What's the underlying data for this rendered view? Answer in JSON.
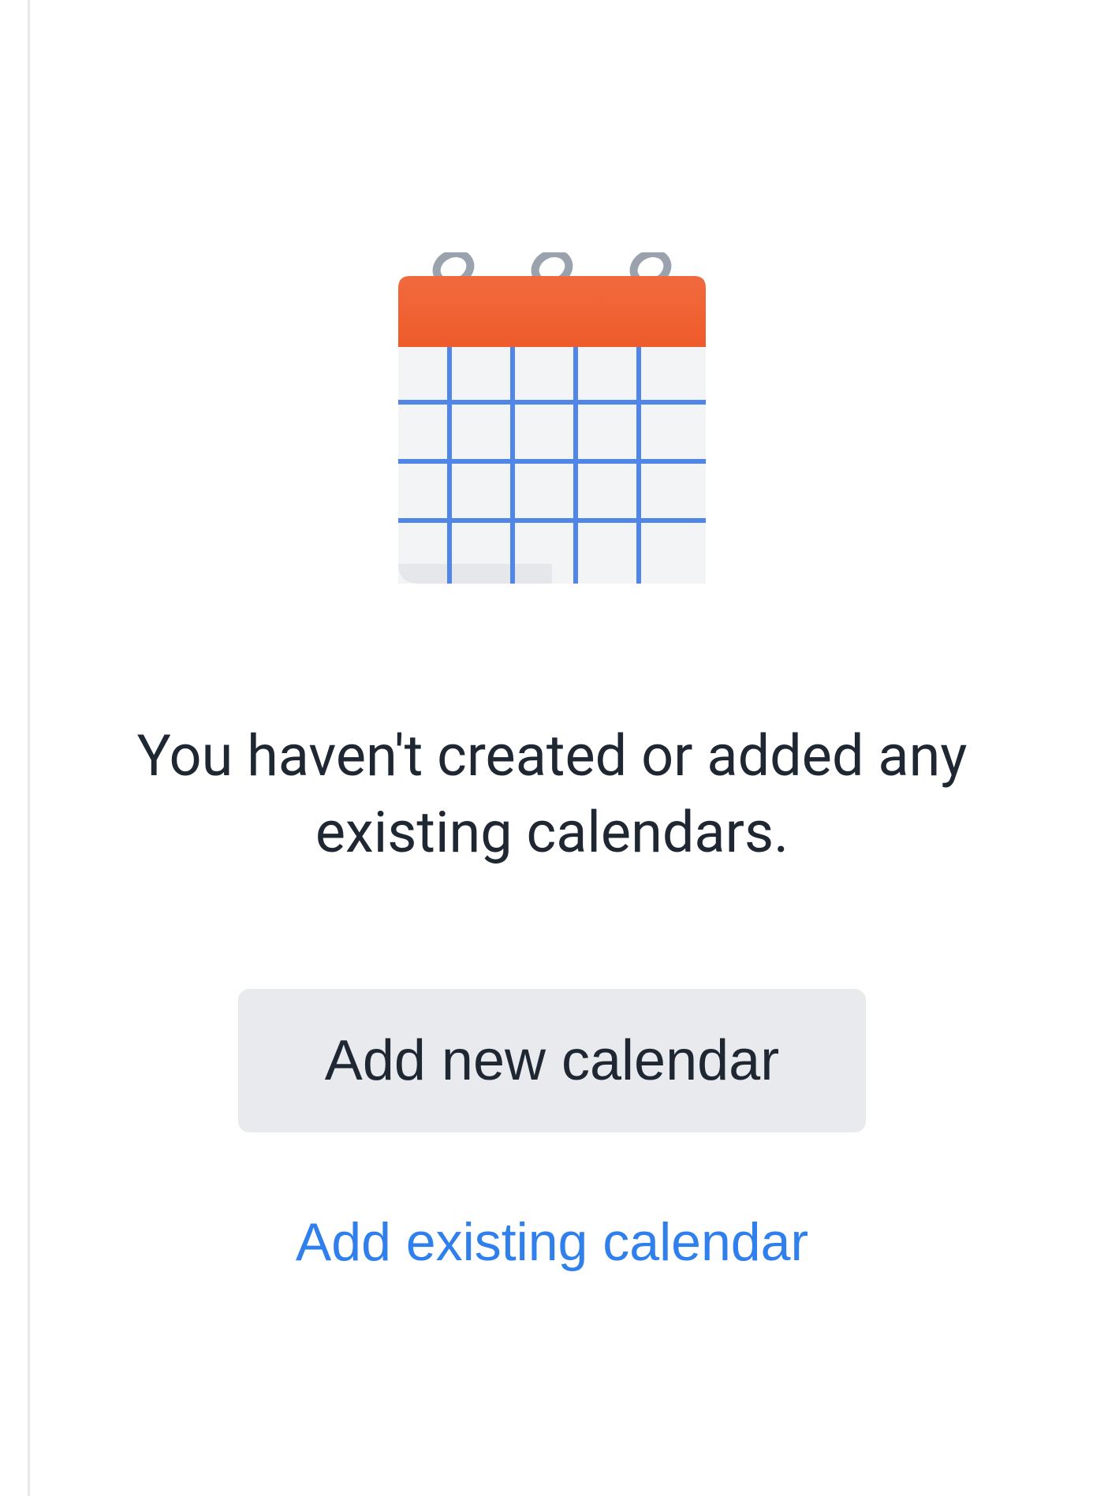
{
  "empty_state": {
    "message": "You haven't created or added any existing calendars.",
    "add_new_label": "Add new calendar",
    "add_existing_label": "Add existing calendar"
  }
}
